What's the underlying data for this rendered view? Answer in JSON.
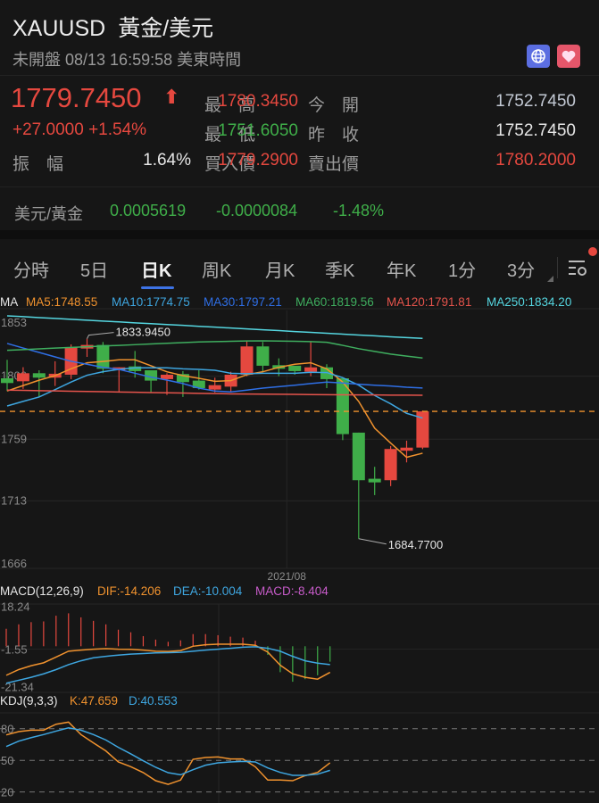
{
  "header": {
    "symbol": "XAUUSD",
    "name": "黃金/美元",
    "status": "未開盤 08/13 16:59:58 美東時間",
    "icons": [
      "globe-icon",
      "heart-icon"
    ],
    "icon_colors": {
      "globe": "#5b6ee1",
      "heart": "#e5566a"
    }
  },
  "quote": {
    "price": "1779.7450",
    "change": "+27.0000",
    "change_pct": "+1.54%",
    "direction": "up",
    "amplitude_label": "振　幅",
    "amplitude": "1.64%",
    "high_label": "最　高",
    "high": "1780.3450",
    "low_label": "最　低",
    "low": "1751.6050",
    "bid_label": "買入價",
    "bid": "1779.2900",
    "open_label": "今　開",
    "open": "1752.7450",
    "prev_close_label": "昨　收",
    "prev_close": "1752.7450",
    "ask_label": "賣出價",
    "ask": "1780.2000"
  },
  "inverse": {
    "label": "美元/黃金",
    "price": "0.0005619",
    "change": "-0.0000084",
    "change_pct": "-1.48%"
  },
  "tabs": [
    {
      "label": "分時"
    },
    {
      "label": "5日"
    },
    {
      "label": "日K",
      "active": true
    },
    {
      "label": "周K"
    },
    {
      "label": "月K"
    },
    {
      "label": "季K"
    },
    {
      "label": "年K"
    },
    {
      "label": "1分"
    },
    {
      "label": "3分"
    }
  ],
  "colors": {
    "up": "#e5483f",
    "down": "#3fae49",
    "accent": "#3d73e6"
  },
  "chart_data": [
    {
      "type": "candlestick",
      "legend": {
        "title": "MA",
        "items": [
          {
            "label": "MA5:1748.55",
            "color": "#f0922e"
          },
          {
            "label": "MA10:1774.75",
            "color": "#3ea6e0"
          },
          {
            "label": "MA30:1797.21",
            "color": "#2f6fe6"
          },
          {
            "label": "MA60:1819.56",
            "color": "#3fae5f"
          },
          {
            "label": "MA120:1791.81",
            "color": "#e5544c"
          },
          {
            "label": "MA250:1834.20",
            "color": "#55d6e0"
          }
        ]
      },
      "y_ticks": [
        "1853",
        "1806",
        "1759",
        "1713",
        "1666"
      ],
      "ylim": [
        1666,
        1853
      ],
      "x_label": "2021/08",
      "x_label_index": 17.5,
      "last_price": 1779.745,
      "max_annotation": {
        "label": "1833.9450",
        "index": 5,
        "value": 1833.945
      },
      "min_annotation": {
        "label": "1684.7700",
        "index": 22,
        "value": 1684.77
      },
      "ohlc": [
        [
          1804.4,
          1818.2,
          1794.9,
          1800.9
        ],
        [
          1802.2,
          1812.7,
          1796.5,
          1808.2
        ],
        [
          1808.2,
          1810.4,
          1790.5,
          1804.9
        ],
        [
          1804.9,
          1817.1,
          1798.7,
          1807.8
        ],
        [
          1807.1,
          1829.7,
          1803.8,
          1827.5
        ],
        [
          1826.6,
          1833.945,
          1820.4,
          1829.3
        ],
        [
          1829.3,
          1831.5,
          1808.2,
          1811.5
        ],
        [
          1810.4,
          1812.6,
          1794.2,
          1812.6
        ],
        [
          1813.3,
          1824.8,
          1804.9,
          1809.8
        ],
        [
          1810.4,
          1810.4,
          1793.8,
          1802.7
        ],
        [
          1803.8,
          1808.2,
          1792.0,
          1807.1
        ],
        [
          1807.6,
          1809.8,
          1790.5,
          1801.6
        ],
        [
          1802.7,
          1810.4,
          1796.0,
          1797.1
        ],
        [
          1796.0,
          1804.9,
          1793.8,
          1799.3
        ],
        [
          1798.2,
          1809.3,
          1793.8,
          1807.1
        ],
        [
          1807.1,
          1832.6,
          1806.0,
          1828.2
        ],
        [
          1828.2,
          1831.5,
          1809.3,
          1813.8
        ],
        [
          1814.2,
          1819.3,
          1806.0,
          1811.5
        ],
        [
          1813.8,
          1813.8,
          1807.1,
          1809.8
        ],
        [
          1809.3,
          1831.5,
          1806.0,
          1812.6
        ],
        [
          1812.6,
          1814.9,
          1797.1,
          1803.8
        ],
        [
          1804.4,
          1804.4,
          1758.3,
          1762.8
        ],
        [
          1763.9,
          1763.9,
          1684.77,
          1728.4
        ],
        [
          1729.5,
          1738.4,
          1717.3,
          1726.8
        ],
        [
          1728.4,
          1753.9,
          1724.0,
          1751.7
        ],
        [
          1750.4,
          1757.9,
          1741.7,
          1752.7
        ],
        [
          1752.745,
          1780.345,
          1751.605,
          1779.745
        ]
      ],
      "ma": {
        "MA5": [
          1795,
          1799,
          1803,
          1806.4,
          1811.5,
          1816,
          1817,
          1818.2,
          1818.2,
          1813.8,
          1809.3,
          1806.4,
          1804.4,
          1802.2,
          1802.7,
          1807.1,
          1809.3,
          1812.6,
          1814.9,
          1816,
          1811.5,
          1801.6,
          1787.2,
          1767.2,
          1756.1,
          1745.5,
          1748.55
        ],
        "MA10": [
          1783.8,
          1787.2,
          1790.5,
          1796,
          1801.6,
          1806.7,
          1809.3,
          1811.1,
          1812.2,
          1812.2,
          1812.2,
          1811.5,
          1811.1,
          1810.4,
          1808.2,
          1807.8,
          1808.2,
          1808.2,
          1808.2,
          1808.9,
          1808.7,
          1804.9,
          1799.3,
          1791.6,
          1785.4,
          1778.3,
          1774.75
        ],
        "MA30": [
          1830.4,
          1827,
          1823.7,
          1820.4,
          1817.1,
          1814.9,
          1812.6,
          1811.1,
          1808.2,
          1805.3,
          1803.1,
          1800.5,
          1797.1,
          1794.9,
          1794.3,
          1795.6,
          1797.1,
          1798.2,
          1799.3,
          1800.5,
          1801.6,
          1800.9,
          1800,
          1799.3,
          1798.7,
          1797.8,
          1797.21
        ],
        "MA60": [
          1825.3,
          1825.8,
          1826.4,
          1827,
          1827.5,
          1828,
          1828.5,
          1829,
          1829.5,
          1830,
          1830.5,
          1831,
          1831.5,
          1831.8,
          1832,
          1832.3,
          1832.4,
          1832.2,
          1832,
          1831.8,
          1831.3,
          1829,
          1826.5,
          1824.5,
          1822.5,
          1821,
          1819.56
        ],
        "MA120": [
          1795.6,
          1795.4,
          1795.2,
          1795,
          1794.8,
          1794.6,
          1794.4,
          1794.2,
          1794,
          1793.8,
          1793.6,
          1793.4,
          1793.2,
          1793,
          1792.8,
          1792.7,
          1792.6,
          1792.5,
          1792.4,
          1792.3,
          1792.2,
          1792.1,
          1792,
          1792,
          1791.9,
          1791.9,
          1791.81
        ],
        "MA250": [
          1851,
          1850.4,
          1849.7,
          1849.1,
          1848.4,
          1847.8,
          1847.1,
          1846.5,
          1845.8,
          1845.2,
          1844.5,
          1843.9,
          1843.2,
          1842.6,
          1841.9,
          1841.3,
          1840.6,
          1840,
          1839.3,
          1838.7,
          1838,
          1837.4,
          1836.7,
          1836.1,
          1835.4,
          1834.8,
          1834.2
        ]
      }
    },
    {
      "type": "bar+line",
      "title": "MACD(12,26,9)",
      "legend": [
        {
          "label": "DIF:-14.206",
          "color": "#f0922e"
        },
        {
          "label": "DEA:-10.004",
          "color": "#3ea6e0"
        },
        {
          "label": "MACD:-8.404",
          "color": "#c75bc9"
        }
      ],
      "y_ticks": [
        "18.24",
        "-1.55",
        "-21.34"
      ],
      "ylim": [
        -21.34,
        18.24
      ],
      "macd": [
        9.5,
        11.9,
        13.1,
        13.5,
        16.6,
        17.9,
        15.7,
        13.8,
        11.9,
        9.0,
        7.6,
        5.5,
        3.6,
        2.4,
        3.2,
        6.6,
        6.6,
        6.0,
        5.2,
        4.7,
        3.0,
        -4.7,
        -14.1,
        -19.3,
        -17.9,
        -15.8,
        -8.404
      ],
      "dif": [
        -15.8,
        -12.7,
        -10.6,
        -9.0,
        -5.9,
        -2.7,
        -2.1,
        -1.6,
        -1.3,
        -1.6,
        -1.7,
        -2.1,
        -2.7,
        -2.8,
        -2.4,
        0,
        0.8,
        1.1,
        1.1,
        1.1,
        0.5,
        -3.2,
        -10.3,
        -15.0,
        -16.9,
        -17.9,
        -14.206
      ],
      "dea": [
        -20.1,
        -18.5,
        -16.9,
        -15.0,
        -12.7,
        -10.0,
        -7.9,
        -6.3,
        -5.5,
        -4.8,
        -4.3,
        -4.0,
        -3.6,
        -3.5,
        -3.3,
        -2.7,
        -2.1,
        -1.6,
        -1.1,
        -0.5,
        -0.3,
        -1.1,
        -2.7,
        -5.5,
        -7.9,
        -9.2,
        -10.004
      ]
    },
    {
      "type": "line",
      "title": "KDJ(9,3,3)",
      "legend": [
        {
          "label": "K:47.659",
          "color": "#f0922e"
        },
        {
          "label": "D:40.553",
          "color": "#3ea6e0"
        }
      ],
      "y_ticks": [
        "80",
        "50",
        "20"
      ],
      "ref_lines": [
        80,
        50,
        20
      ],
      "k": [
        74.1,
        77.2,
        78.6,
        78.6,
        84.2,
        86.2,
        74.4,
        66.5,
        58.9,
        48.5,
        44,
        38.4,
        30.7,
        27.3,
        31.3,
        51,
        52.7,
        53.2,
        51.3,
        51.3,
        43.9,
        31.3,
        31.3,
        30.7,
        35.5,
        38.6,
        47.659
      ],
      "d": [
        63.1,
        68.2,
        71.5,
        74.4,
        77.7,
        80.8,
        78.6,
        74.4,
        69.3,
        62.3,
        56.1,
        49.6,
        43.4,
        38.3,
        36.3,
        41.1,
        45.4,
        47.6,
        48.5,
        49,
        48.5,
        42.8,
        38.6,
        35.8,
        35.8,
        36.9,
        40.553
      ]
    }
  ]
}
